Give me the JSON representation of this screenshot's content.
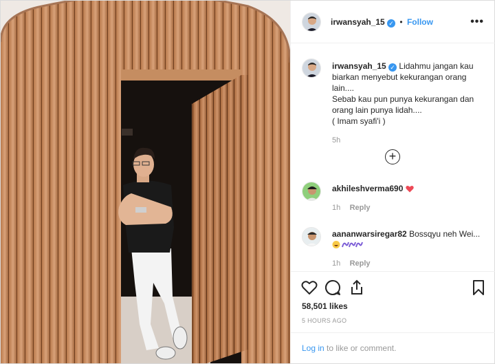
{
  "post": {
    "author": "irwansyah_15",
    "separator": "•",
    "follow_label": "Follow",
    "more_icon": "more-options-icon",
    "verified_icon": "verified-badge-icon"
  },
  "caption": {
    "author": "irwansyah_15",
    "lines": [
      "Lidahmu jangan kau",
      "biarkan menyebut kekurangan orang",
      "lain....",
      "Sebab kau pun punya kekurangan dan",
      "orang lain punya lidah....",
      "( Imam syafi'i )"
    ],
    "time": "5h"
  },
  "load_more_icon": "plus-circle-icon",
  "comments": [
    {
      "user": "akhileshverma690",
      "text": "",
      "emoji": "heart",
      "time": "1h",
      "reply": "Reply"
    },
    {
      "user": "aananwarsiregar82",
      "text": "Bossqyu neh Wei...",
      "emoji": "laugh-and-waves",
      "time": "1h",
      "reply": "Reply"
    }
  ],
  "actions": {
    "like_icon": "heart-icon",
    "comment_icon": "comment-icon",
    "share_icon": "share-icon",
    "save_icon": "bookmark-icon"
  },
  "likes": "58,501 likes",
  "posted_ago": "5 HOURS AGO",
  "login": {
    "link": "Log in",
    "rest": " to like or comment."
  },
  "colors": {
    "accent": "#3897f0",
    "heart": "#ed4956",
    "text": "#262626",
    "muted": "#999999"
  }
}
